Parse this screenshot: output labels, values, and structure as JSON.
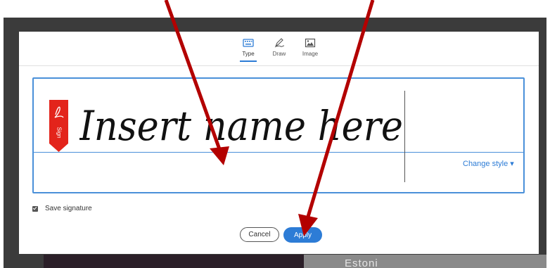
{
  "tabs": [
    {
      "label": "Type",
      "icon": "keyboard-icon",
      "active": true
    },
    {
      "label": "Draw",
      "icon": "pen-icon",
      "active": false
    },
    {
      "label": "Image",
      "icon": "image-icon",
      "active": false
    }
  ],
  "signature": {
    "text": "Insert name here",
    "sign_badge": "Sign",
    "change_style": "Change style ▾"
  },
  "save": {
    "label": "Save signature",
    "checked": true
  },
  "buttons": {
    "cancel": "Cancel",
    "apply": "Apply"
  },
  "background": {
    "partial_text": "Estoni"
  },
  "colors": {
    "accent": "#2d7cd6",
    "arrow": "#b30000",
    "sign_flag": "#e3241b"
  }
}
